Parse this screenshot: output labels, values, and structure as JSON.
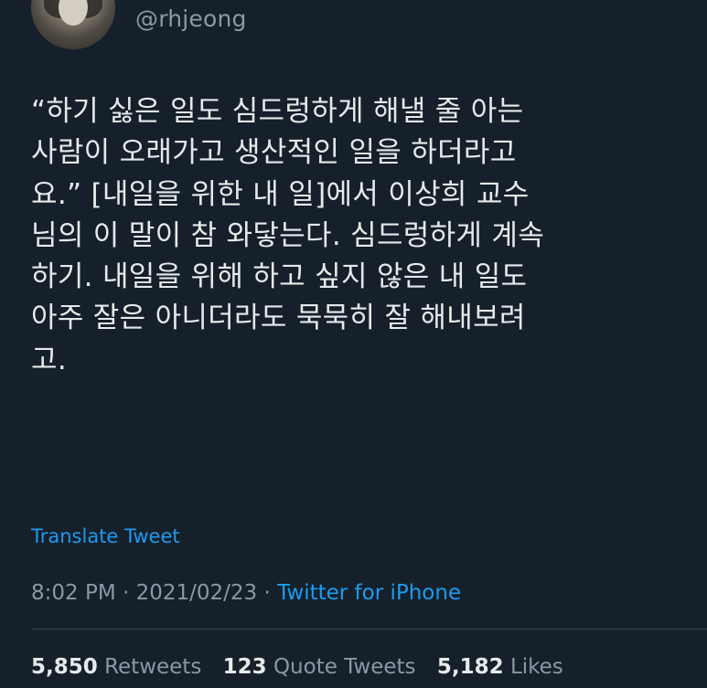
{
  "author": {
    "handle": "@rhjeong"
  },
  "tweet": {
    "lines": [
      "“하기 싫은 일도 심드렁하게 해낼 줄 아는",
      "사람이 오래가고 생산적인 일을 하더라고",
      "요.” [내일을 위한 내 일]에서 이상희 교수",
      "님의 이 말이 참 와닿는다. 심드렁하게 계속",
      "하기. 내일을 위해 하고 싶지 않은 내 일도",
      "아주 잘은 아니더라도 묵묵히 잘 해내보려",
      "고."
    ],
    "translate_label": "Translate Tweet",
    "time": "8:02 PM",
    "separator": "·",
    "date": "2021/02/23",
    "source": "Twitter for iPhone"
  },
  "stats": {
    "retweets_count": "5,850",
    "retweets_label": "Retweets",
    "quotes_count": "123",
    "quotes_label": "Quote Tweets",
    "likes_count": "5,182",
    "likes_label": "Likes"
  },
  "colors": {
    "background": "#15202b",
    "text": "#e7e9ea",
    "secondary": "#8b98a5",
    "link": "#1d9bf0"
  }
}
